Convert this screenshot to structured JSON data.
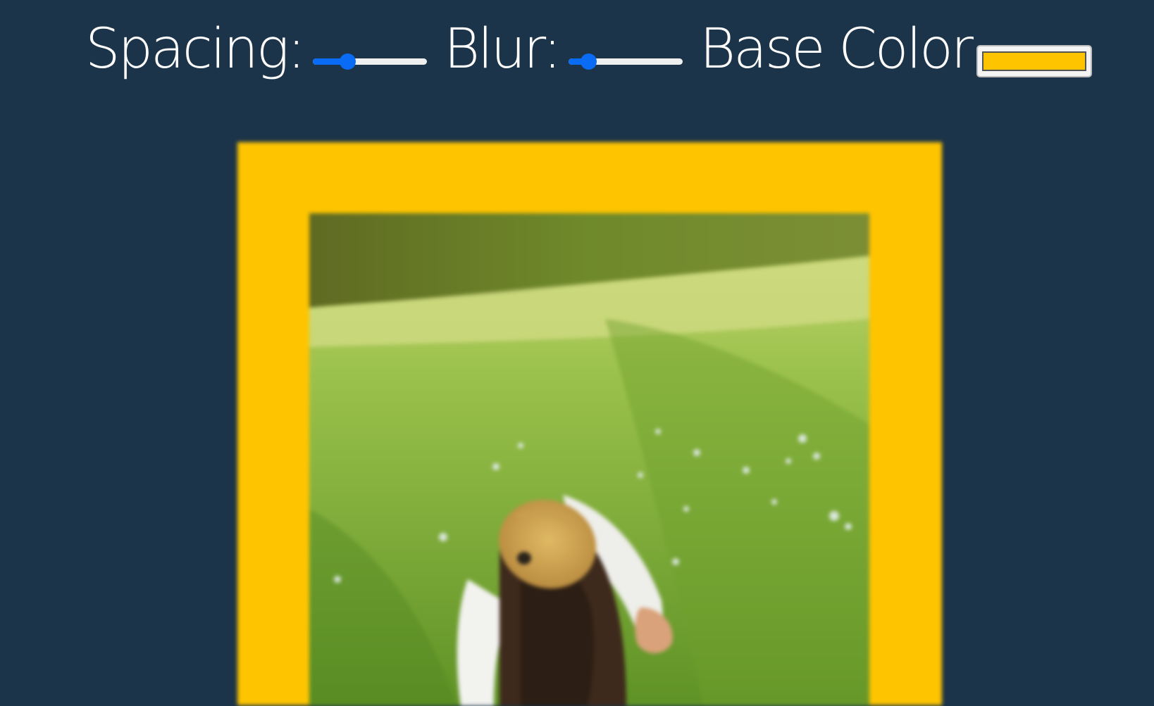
{
  "controls": {
    "spacing": {
      "label": "Spacing:",
      "value": 0.3
    },
    "blur": {
      "label": "Blur:",
      "value": 0.17
    },
    "base_color": {
      "label": "Base Color",
      "value": "#fec400"
    }
  },
  "colors": {
    "background": "#1b3449",
    "slider_accent": "#0a6cf5",
    "slider_track": "#efefef",
    "frame": "#fec400"
  },
  "image": {
    "description_icon": "photo-grass-field-icon"
  }
}
